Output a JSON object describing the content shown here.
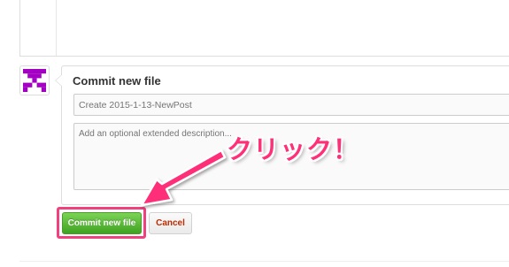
{
  "commit": {
    "title": "Commit new file",
    "summary_placeholder": "Create 2015-1-13-NewPost",
    "description_placeholder": "Add an optional extended description..."
  },
  "buttons": {
    "commit_label": "Commit new file",
    "cancel_label": "Cancel"
  },
  "annotation": {
    "text": "クリック！",
    "color": "#ff2f78"
  },
  "colors": {
    "commit_green": "#3fa221",
    "cancel_red": "#bd2c00",
    "avatar_purple": "#a300c4"
  },
  "icons": {
    "avatar": "identicon",
    "pointer": "arrow"
  }
}
